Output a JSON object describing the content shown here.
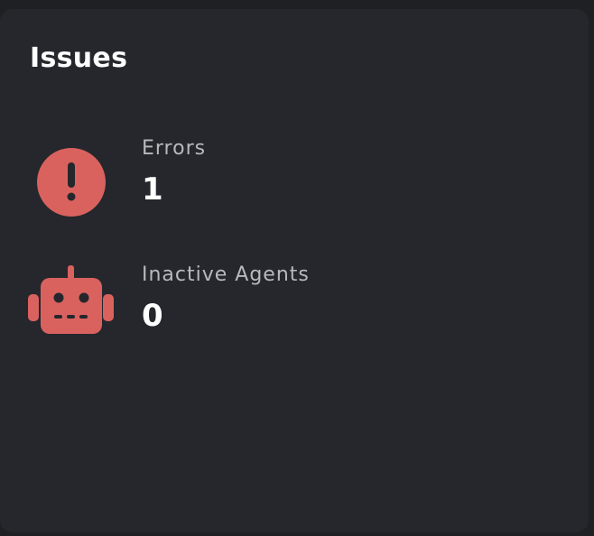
{
  "card": {
    "title": "Issues"
  },
  "metrics": [
    {
      "label": "Errors",
      "value": "1",
      "icon": "alert-circle-icon"
    },
    {
      "label": "Inactive Agents",
      "value": "0",
      "icon": "robot-icon"
    }
  ],
  "colors": {
    "background": "#1e2024",
    "card": "#25272c",
    "accent_red": "#d9625f",
    "label": "#b7b9bd",
    "value": "#ffffff"
  }
}
